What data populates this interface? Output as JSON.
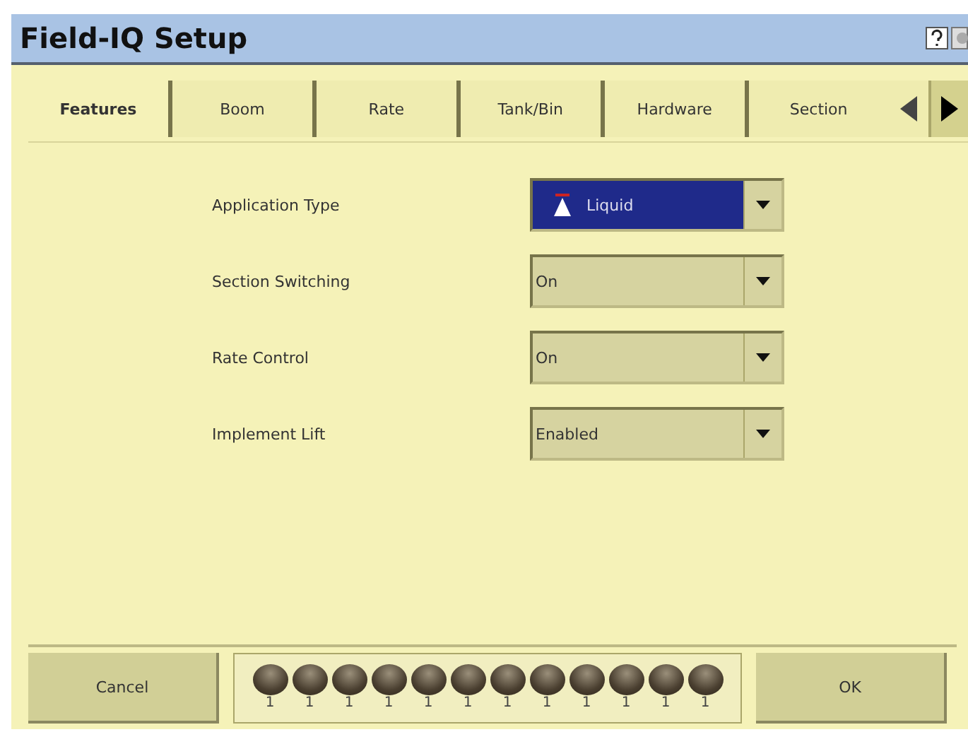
{
  "window": {
    "title": "Field-IQ Setup"
  },
  "tabs": [
    {
      "label": "Features",
      "selected": true
    },
    {
      "label": "Boom",
      "selected": false
    },
    {
      "label": "Rate",
      "selected": false
    },
    {
      "label": "Tank/Bin",
      "selected": false
    },
    {
      "label": "Hardware",
      "selected": false
    },
    {
      "label": "Section",
      "selected": false
    }
  ],
  "fields": [
    {
      "label": "Application Type",
      "value": "Liquid",
      "kind": "highlighted"
    },
    {
      "label": "Section Switching",
      "value": "On",
      "kind": "plain"
    },
    {
      "label": "Rate Control",
      "value": "On",
      "kind": "plain"
    },
    {
      "label": "Implement Lift",
      "value": "Enabled",
      "kind": "plain"
    }
  ],
  "sections": [
    "1",
    "1",
    "1",
    "1",
    "1",
    "1",
    "1",
    "1",
    "1",
    "1",
    "1",
    "1"
  ],
  "buttons": {
    "cancel": "Cancel",
    "ok": "OK"
  }
}
